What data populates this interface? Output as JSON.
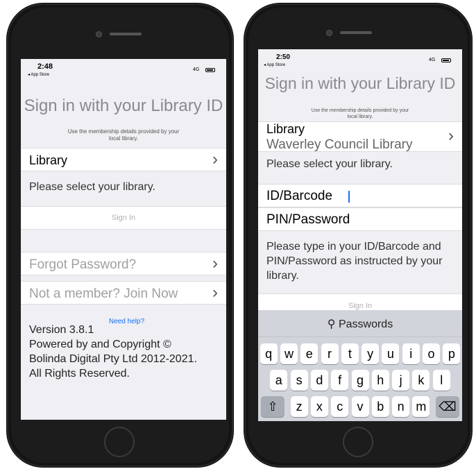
{
  "left_screen": {
    "status_time": "2:48",
    "back_label": "◂ App Store",
    "network": "4G",
    "title": "Sign in with your Library ID",
    "subtitle_line1": "Use the membership details provided by your",
    "subtitle_line2": "local library.",
    "library_label": "Library",
    "library_hint": "Please select your library.",
    "sign_in_label": "Sign In",
    "forgot_label": "Forgot Password?",
    "join_label": "Not a member? Join Now",
    "need_help": "Need help?",
    "version": "Version 3.8.1",
    "copyright_line1": "Powered by and Copyright ©",
    "copyright_line2": "Bolinda Digital Pty Ltd 2012-2021.",
    "copyright_line3": "All Rights Reserved."
  },
  "right_screen": {
    "status_time": "2:50",
    "back_label": "◂ App Store",
    "network": "4G",
    "title": "Sign in with your Library ID",
    "subtitle_line1": "Use the membership details provided by your",
    "subtitle_line2": "local library.",
    "library_label": "Library",
    "library_value": "Waverley Council Library",
    "library_hint": "Please select your library.",
    "id_label": "ID/Barcode",
    "pin_label": "PIN/Password",
    "instructions": "Please type in your ID/Barcode and PIN/Password as instructed by your library.",
    "sign_in_label": "Sign In",
    "keyboard_passwords": "Passwords",
    "key_icon": "key-icon",
    "keyboard_rows": [
      [
        "q",
        "w",
        "e",
        "r",
        "t",
        "y",
        "u",
        "i",
        "o",
        "p"
      ],
      [
        "a",
        "s",
        "d",
        "f",
        "g",
        "h",
        "j",
        "k",
        "l"
      ],
      [
        "z",
        "x",
        "c",
        "v",
        "b",
        "n",
        "m"
      ]
    ]
  },
  "icons": {
    "chevron": "›",
    "shift": "⇧",
    "backspace": "⌫"
  },
  "colors": {
    "link": "#1a6ef5",
    "background": "#efeff4"
  }
}
